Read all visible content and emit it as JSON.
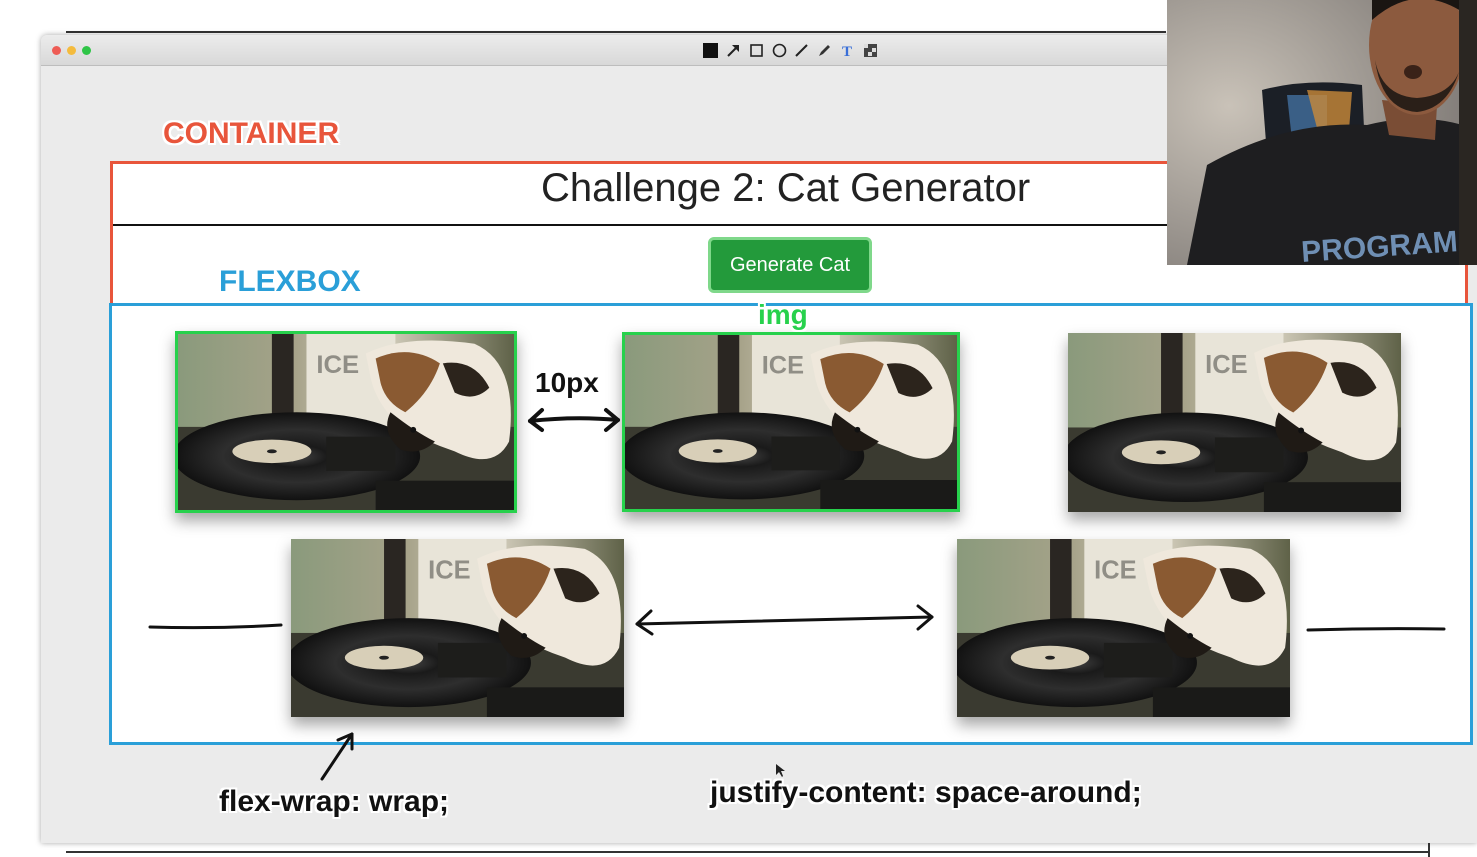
{
  "toolbar": {
    "tools": [
      "filled-square-icon",
      "arrow-icon",
      "rectangle-icon",
      "circle-icon",
      "line-icon",
      "pen-icon",
      "text-tool-icon",
      "pixelate-icon"
    ]
  },
  "page": {
    "title": "Challenge 2: Cat Generator",
    "generate_button": "Generate Cat"
  },
  "annotations": {
    "container_label": "CONTAINER",
    "flexbox_label": "FLEXBOX",
    "img_label": "img",
    "gap_label": "10px",
    "flex_wrap": "flex-wrap: wrap;",
    "justify_content": "justify-content: space-around;"
  },
  "webcam": {
    "shirt_text": "PROGRAM"
  },
  "colors": {
    "container_outline": "#e8553b",
    "flexbox_outline": "#2a9fd8",
    "img_highlight": "#27d14c",
    "button_bg": "#239a3b"
  }
}
